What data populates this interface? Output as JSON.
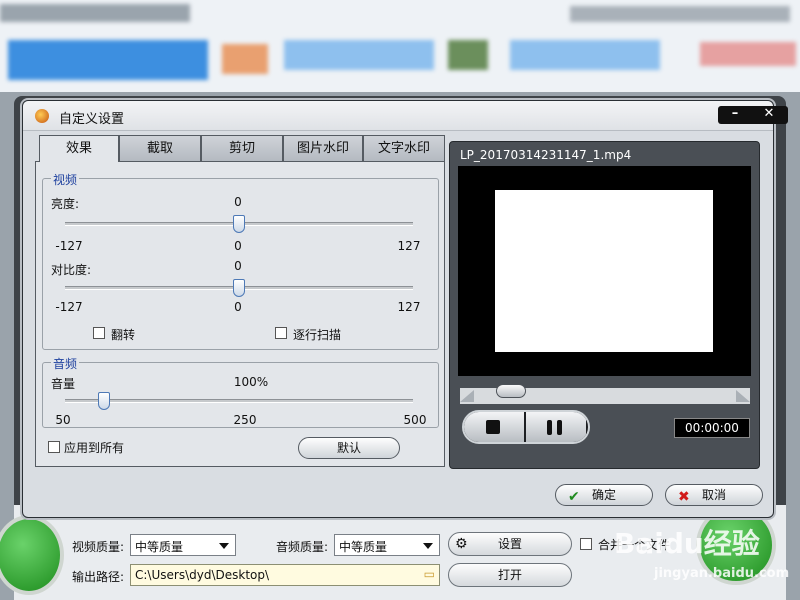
{
  "dialog": {
    "title": "自定义设置",
    "minimize": "–",
    "close": "✕",
    "tabs": [
      "效果",
      "截取",
      "剪切",
      "图片水印",
      "文字水印"
    ],
    "video_group": {
      "title": "视频",
      "brightness": {
        "label": "亮度:",
        "value": "0",
        "min": "-127",
        "mid": "0",
        "max": "127",
        "level": 0
      },
      "contrast": {
        "label": "对比度:",
        "value": "0",
        "min": "-127",
        "mid": "0",
        "max": "127",
        "level": 0
      },
      "flip_label": "翻转",
      "deinterlace_label": "逐行扫描"
    },
    "audio_group": {
      "title": "音频",
      "volume": {
        "label": "音量",
        "value": "100%",
        "min": "50",
        "mid": "250",
        "max": "500",
        "level": 100
      }
    },
    "apply_all_label": "应用到所有",
    "default_button": "默认",
    "preview": {
      "file_name": "LP_20170314231147_1.mp4",
      "time": "00:00:00"
    },
    "ok_label": "确定",
    "cancel_label": "取消"
  },
  "background": {
    "video_quality_label": "视频质量:",
    "video_quality_value": "中等质量",
    "audio_quality_label": "音频质量:",
    "audio_quality_value": "中等质量",
    "settings_button": "设置",
    "merge_label": "合并一个文件",
    "output_path_label": "输出路径:",
    "output_path_value": "C:\\Users\\dyd\\Desktop\\",
    "open_button": "打开",
    "watermark_text": "Baidu经验",
    "watermark_url": "jingyan.baidu.com"
  },
  "colors": {
    "group_title": "#1c3f9e",
    "ok_icon": "#1f8a1f",
    "cancel_icon": "#d11a1a"
  }
}
